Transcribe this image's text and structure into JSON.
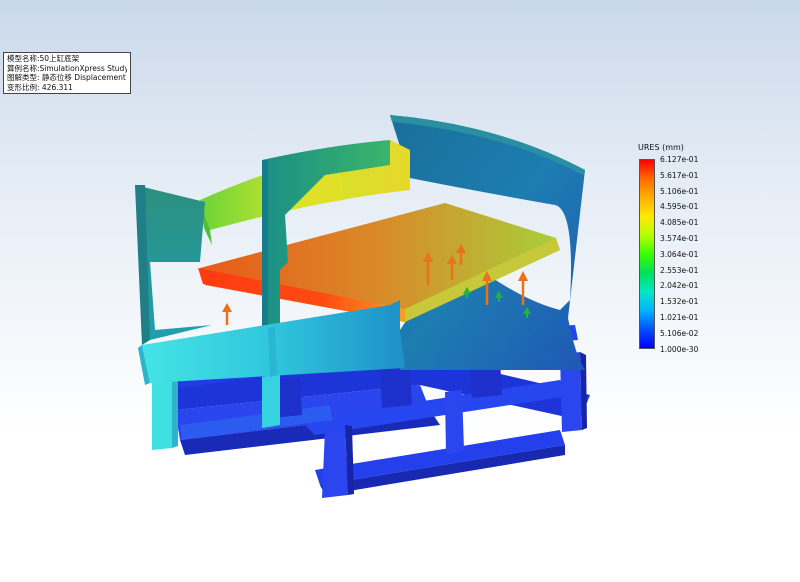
{
  "info_box": {
    "lines": [
      "模型名称:50上缸底架",
      "算例名称:SimulationXpress Study[-默认-]",
      "图解类型: 静态位移 Displacement",
      "变形比例: 426.311"
    ]
  },
  "legend": {
    "title": "URES (mm)",
    "values": [
      "6.127e-01",
      "5.617e-01",
      "5.106e-01",
      "4.595e-01",
      "4.085e-01",
      "3.574e-01",
      "3.064e-01",
      "2.553e-01",
      "2.042e-01",
      "1.532e-01",
      "1.021e-01",
      "5.106e-02",
      "1.000e-30"
    ]
  },
  "colors": {
    "max": "#ff0000",
    "mid": "#39ff00",
    "min": "#0000ff",
    "load_arrow": "#e8731a",
    "fixture_arrow": "#22b53a"
  },
  "icons": {
    "load_arrow": "arrow-up-icon",
    "fixture_arrow": "fixture-arrow-icon"
  }
}
